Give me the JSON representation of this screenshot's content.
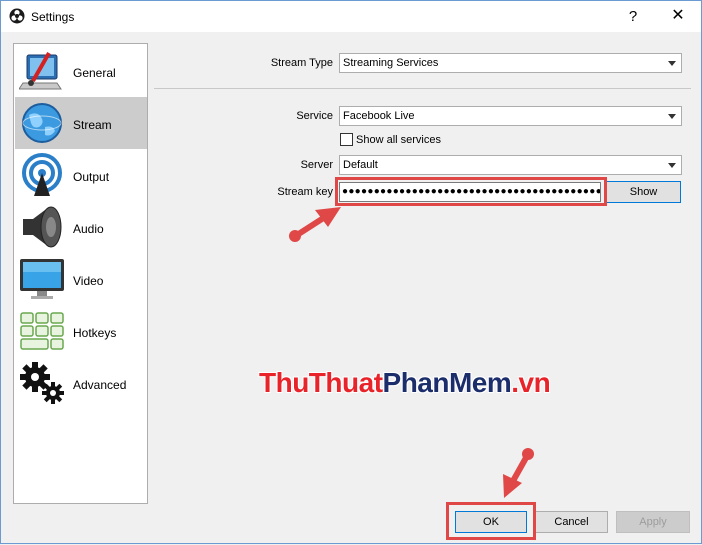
{
  "window": {
    "title": "Settings",
    "help_glyph": "?",
    "close_glyph": "✕"
  },
  "sidebar": {
    "items": [
      {
        "label": "General",
        "icon": "general-icon"
      },
      {
        "label": "Stream",
        "icon": "stream-icon",
        "selected": true
      },
      {
        "label": "Output",
        "icon": "output-icon"
      },
      {
        "label": "Audio",
        "icon": "audio-icon"
      },
      {
        "label": "Video",
        "icon": "video-icon"
      },
      {
        "label": "Hotkeys",
        "icon": "hotkeys-icon"
      },
      {
        "label": "Advanced",
        "icon": "advanced-icon"
      }
    ]
  },
  "stream": {
    "stream_type_label": "Stream Type",
    "stream_type_value": "Streaming Services",
    "service_label": "Service",
    "service_value": "Facebook Live",
    "show_all_label": "Show all services",
    "show_all_checked": false,
    "server_label": "Server",
    "server_value": "Default",
    "stream_key_label": "Stream key",
    "stream_key_masked": "●●●●●●●●●●●●●●●●●●●●●●●●●●●●●●●●●●●●●●●●●",
    "show_button": "Show"
  },
  "footer": {
    "ok": "OK",
    "cancel": "Cancel",
    "apply": "Apply"
  },
  "watermark": {
    "part1": "ThuThuat",
    "part2": "PhanMem",
    "part3": ".vn"
  },
  "colors": {
    "highlight": "#e04848",
    "selected_bg": "#cccccc",
    "accent": "#0078d7"
  }
}
